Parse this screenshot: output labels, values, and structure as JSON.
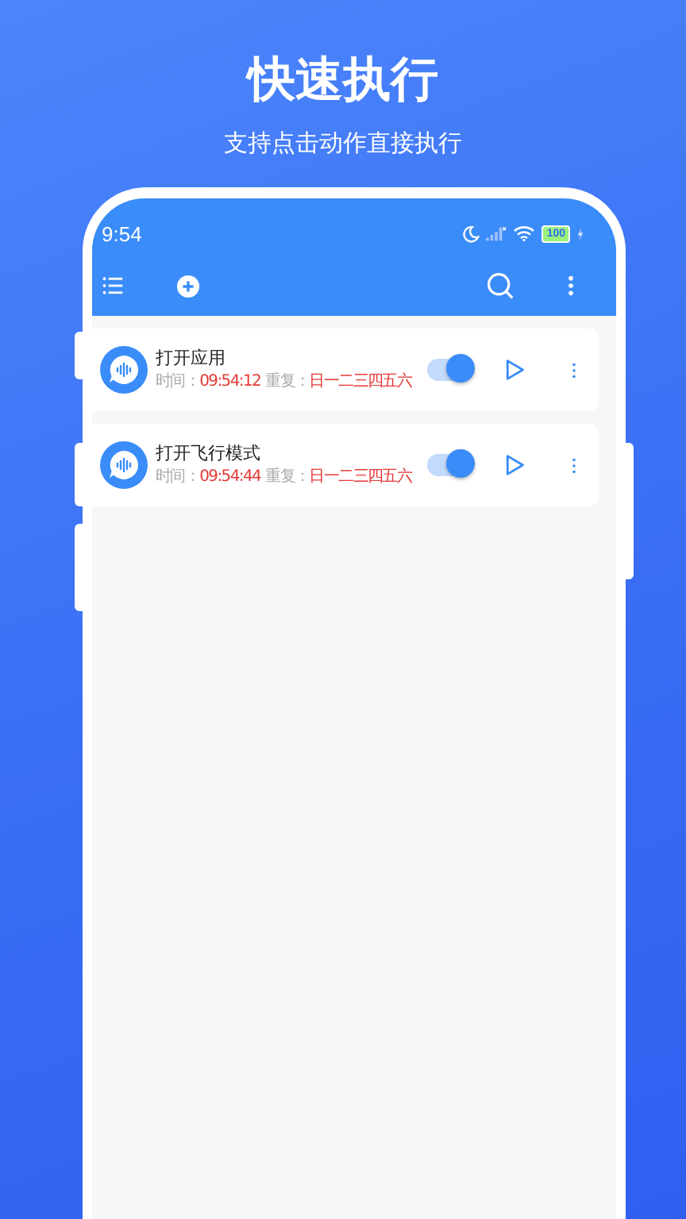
{
  "hero": {
    "title": "快速执行",
    "subtitle": "支持点击动作直接执行"
  },
  "status_bar": {
    "time": "9:54",
    "battery": "100"
  },
  "tasks": [
    {
      "name": "打开应用",
      "time_label": "时间：",
      "time": "09:54:12",
      "repeat_label": "重复：",
      "repeat": "日一二三四五六",
      "on": true
    },
    {
      "name": "打开飞行模式",
      "time_label": "时间：",
      "time": "09:54:44",
      "repeat_label": "重复：",
      "repeat": "日一二三四五六",
      "on": true
    }
  ]
}
